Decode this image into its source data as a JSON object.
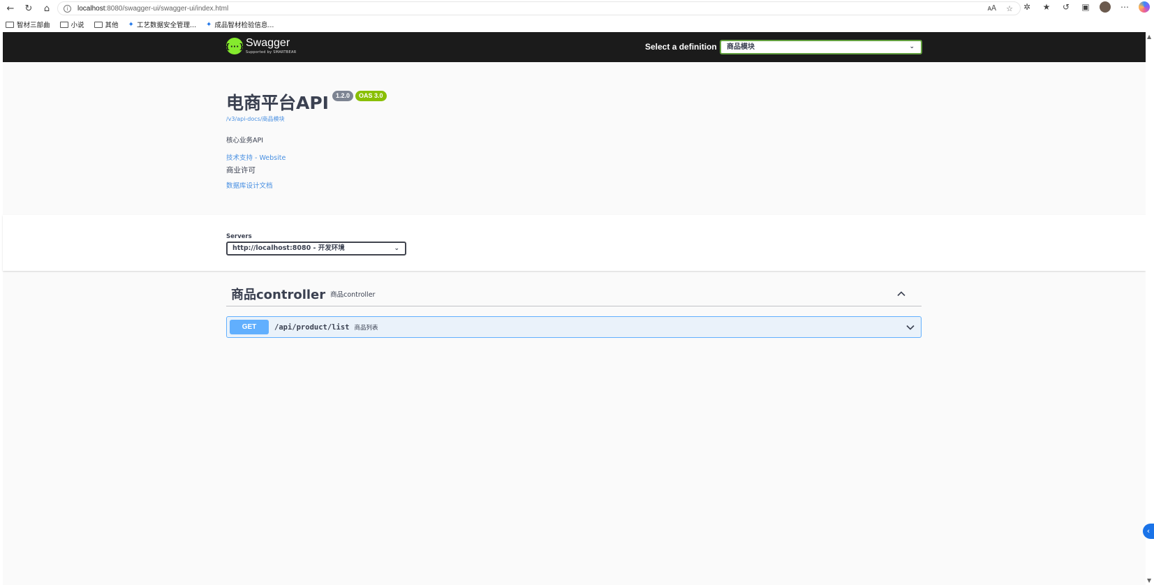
{
  "browser": {
    "address": {
      "host": "localhost",
      "path": ":8080/swagger-ui/swagger-ui/index.html"
    },
    "bookmarks": [
      {
        "label": "智材三部曲",
        "icon": "folder-icon"
      },
      {
        "label": "小说",
        "icon": "folder-icon"
      },
      {
        "label": "其他",
        "icon": "folder-icon"
      },
      {
        "label": "工艺数据安全管理...",
        "icon": "bookmark-icon"
      },
      {
        "label": "成品智材检验信息...",
        "icon": "bookmark-icon"
      }
    ]
  },
  "topbar": {
    "logo_word": "Swagger",
    "logo_sub": "Supported by SMARTBEAR",
    "definition_label": "Select a definition",
    "definition_value": "商品模块"
  },
  "info": {
    "title": "电商平台API",
    "version": "1.2.0",
    "oas": "OAS 3.0",
    "docs_url": "/v3/api-docs/商品模块",
    "description": "核心业务API",
    "contact_link": "技术支持 - Website",
    "license": "商业许可",
    "external_docs": "数据库设计文档"
  },
  "servers": {
    "label": "Servers",
    "selected": "http://localhost:8080 - 开发环境"
  },
  "tag": {
    "name": "商品controller",
    "description": "商品controller",
    "operations": [
      {
        "method": "GET",
        "path": "/api/product/list",
        "summary": "商品列表"
      }
    ]
  },
  "colors": {
    "topbar": "#1b1b1b",
    "swagger_green": "#85ea2d",
    "get_blue": "#61affe",
    "link_blue": "#4990e2",
    "version_gray": "#7d8492",
    "oas_green": "#89bf04"
  }
}
